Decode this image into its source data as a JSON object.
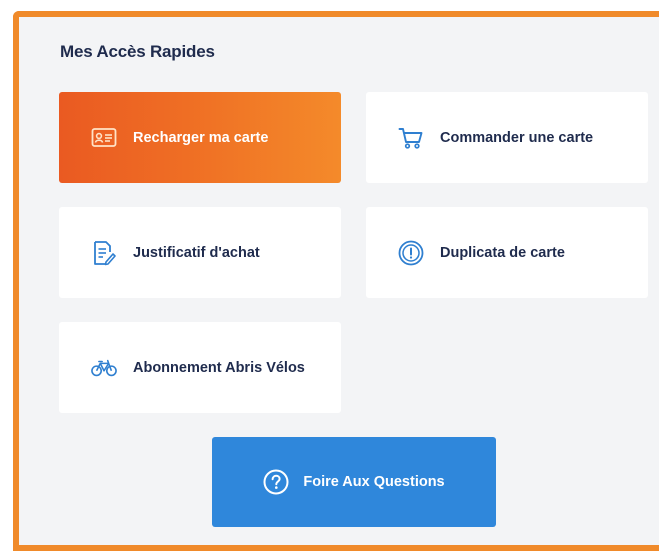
{
  "section": {
    "title": "Mes Accès Rapides"
  },
  "tiles": [
    {
      "label": "Recharger ma carte",
      "icon": "id-card-icon"
    },
    {
      "label": "Commander une carte",
      "icon": "cart-icon"
    },
    {
      "label": "Justificatif d'achat",
      "icon": "document-edit-icon"
    },
    {
      "label": "Duplicata de carte",
      "icon": "exclamation-circle-icon"
    },
    {
      "label": "Abonnement Abris Vélos",
      "icon": "bicycle-icon"
    }
  ],
  "faq": {
    "label": "Foire Aux Questions",
    "icon": "question-circle-icon"
  },
  "colors": {
    "accent_orange": "#f08a2a",
    "primary_gradient_start": "#ea5a22",
    "faq_blue": "#2f87db",
    "icon_blue": "#2f7fd0",
    "text_dark": "#1f2b4d"
  }
}
